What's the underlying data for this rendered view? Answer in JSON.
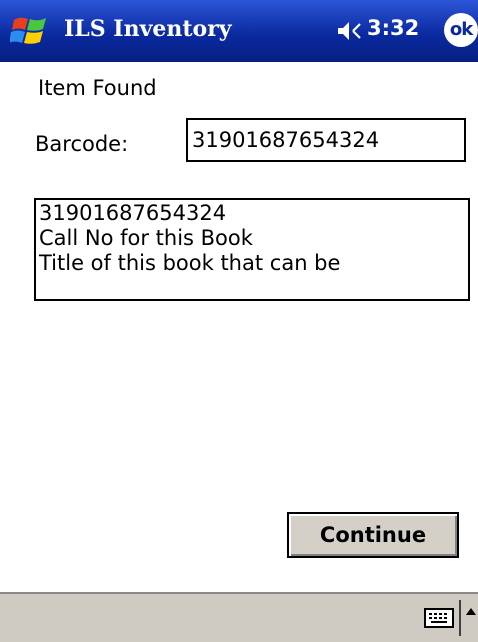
{
  "titlebar": {
    "app_title": "ILS Inventory",
    "time": "3:32",
    "ok_label": "ok",
    "start_icon": "windows-flag-icon",
    "volume_icon": "speaker-icon",
    "color": "#0a2aa0"
  },
  "form": {
    "heading": "Item Found",
    "barcode_label": "Barcode:",
    "barcode_value": "31901687654324",
    "details_lines": [
      "31901687654324",
      "Call No for this Book",
      "Title of this book that can be"
    ],
    "continue_label": "Continue"
  },
  "menubar": {
    "keyboard_icon": "keyboard-icon",
    "sip_arrow_icon": "arrow-up-icon"
  }
}
